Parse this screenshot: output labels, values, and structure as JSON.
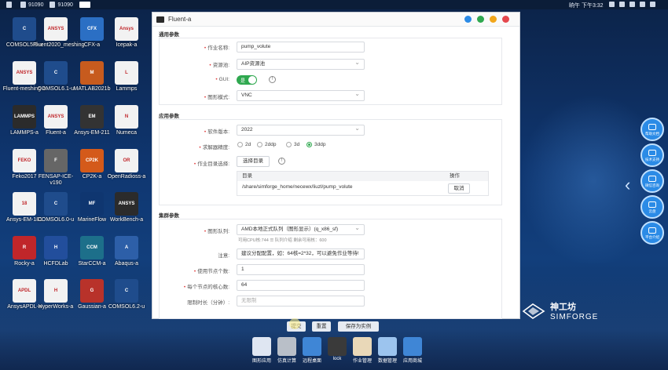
{
  "taskbar": {
    "items": [
      "",
      "91090",
      "91090",
      ""
    ],
    "clock": "晌午 下午3:32"
  },
  "desktop_icons": [
    {
      "label": "COMSOL5.5-u",
      "color": "#1f4c8c",
      "text": "C"
    },
    {
      "label": "Fluent2020_meshing",
      "color": "#f2f2f2",
      "text": "ANSYS"
    },
    {
      "label": "CFX-a",
      "color": "#2b6fc4",
      "text": "CFX"
    },
    {
      "label": "Icepak-a",
      "color": "#f2f2f2",
      "text": "Ansys"
    },
    {
      "label": "Fluent-meshing-a",
      "color": "#f2f2f2",
      "text": "ANSYS"
    },
    {
      "label": "COMSOL6.1-u",
      "color": "#1f4c8c",
      "text": "C"
    },
    {
      "label": "MATLAB2021b",
      "color": "#c75b1e",
      "text": "M"
    },
    {
      "label": "Lammps",
      "color": "#f2f2f2",
      "text": "L"
    },
    {
      "label": "LAMMPS-a",
      "color": "#2b2b2b",
      "text": "LAMMPS"
    },
    {
      "label": "Fluent-a",
      "color": "#f2f2f2",
      "text": "ANSYS"
    },
    {
      "label": "Ansys-EM-211",
      "color": "#333",
      "text": "EM"
    },
    {
      "label": "Numeca",
      "color": "#f2f2f2",
      "text": "N"
    },
    {
      "label": "Feko2017",
      "color": "#f2f2f2",
      "text": "FEKO"
    },
    {
      "label": "FENSAP-ICE-v190",
      "color": "#666",
      "text": "F"
    },
    {
      "label": "CP2K-a",
      "color": "#d45a1a",
      "text": "CP2K"
    },
    {
      "label": "OpenRadioss-a",
      "color": "#f2f2f2",
      "text": "OR"
    },
    {
      "label": "Ansys-EM-181",
      "color": "#f2f2f2",
      "text": "18"
    },
    {
      "label": "COMSOL6.0-u",
      "color": "#1f4c8c",
      "text": "C"
    },
    {
      "label": "MarineFlow",
      "color": "#0f3670",
      "text": "MF"
    },
    {
      "label": "WorkBench-a",
      "color": "#2b2b2b",
      "text": "ANSYS"
    },
    {
      "label": "Rocky-a",
      "color": "#c0262a",
      "text": "R"
    },
    {
      "label": "HCFDLab",
      "color": "#224e9c",
      "text": "H"
    },
    {
      "label": "StarCCM-a",
      "color": "#1d6f8a",
      "text": "CCM"
    },
    {
      "label": "Abaqus-a",
      "color": "#2d5fa8",
      "text": "A"
    },
    {
      "label": "AnsysAPDL-a",
      "color": "#f2f2f2",
      "text": "APDL"
    },
    {
      "label": "HyperWorks-a",
      "color": "#f2f2f2",
      "text": "H"
    },
    {
      "label": "Gaussian-a",
      "color": "#b8322a",
      "text": "G"
    },
    {
      "label": "COMSOL6.2-u",
      "color": "#1f4c8c",
      "text": "C"
    }
  ],
  "window": {
    "title": "Fluent-a",
    "ctrl_colors": [
      "#2b8be6",
      "#2fa84f",
      "#f2a71b",
      "#e5484d"
    ]
  },
  "general": {
    "section_title": "通用参数",
    "job_name_label": "作业名称:",
    "job_name_value": "pump_volute",
    "resource_pool_label": "资源池:",
    "resource_pool_value": "AIP资源池",
    "gui_label": "GUI:",
    "gui_toggle_text": "是",
    "mode_label": "图形模式:",
    "mode_value": "VNC"
  },
  "app": {
    "section_title": "应用参数",
    "version_label": "软件版本:",
    "version_value": "2022",
    "precision_label": "求解器精度:",
    "precision_options": [
      "2d",
      "2ddp",
      "3d",
      "3ddp"
    ],
    "precision_selected": "3ddp",
    "workdir_label": "作业目录选择:",
    "workdir_button": "选择目录",
    "table_headers": [
      "目录",
      "操作"
    ],
    "table_rows": [
      {
        "dir": "/share/simforge_home/necewx/liuzl/pump_volute",
        "action": "取消"
      }
    ]
  },
  "cluster": {
    "section_title": "集群参数",
    "queue_label": "图形队列:",
    "queue_value": "AMD本地正式队列（图形显示）(q_x86_sf)",
    "queue_info": "可用CPU核:744  ☰  队列介绍  剩余可用核：600",
    "notice_label": "注意:",
    "notice_value": "建议分配配置，如：64核=2*32，可以避免作业等待!",
    "nodes_label": "使用节点个数:",
    "nodes_value": "1",
    "cores_label": "每个节点的核心数:",
    "cores_value": "64",
    "timelimit_label": "限制时长（分钟）:",
    "timelimit_placeholder": "无限制"
  },
  "actions": {
    "submit": "提交",
    "reset": "重置",
    "save_template": "保存为实例"
  },
  "dock": [
    {
      "label": "图形应用",
      "color": "#dfe6f2"
    },
    {
      "label": "仿真计算",
      "color": "#b9bfc8"
    },
    {
      "label": "远程桌面",
      "color": "#3f86d6"
    },
    {
      "label": "lock",
      "color": "#3a3a3a"
    },
    {
      "label": "作业管理",
      "color": "#e9d8b8"
    },
    {
      "label": "数据管理",
      "color": "#9cc4ee"
    },
    {
      "label": "应用商城",
      "color": "#3f86d6"
    }
  ],
  "right_bar": [
    "帮助文档",
    "技术支持",
    "微信咨询",
    "云盘",
    "平台介绍"
  ],
  "brand": {
    "cn": "神工坊",
    "en": "SIMFORGE"
  }
}
